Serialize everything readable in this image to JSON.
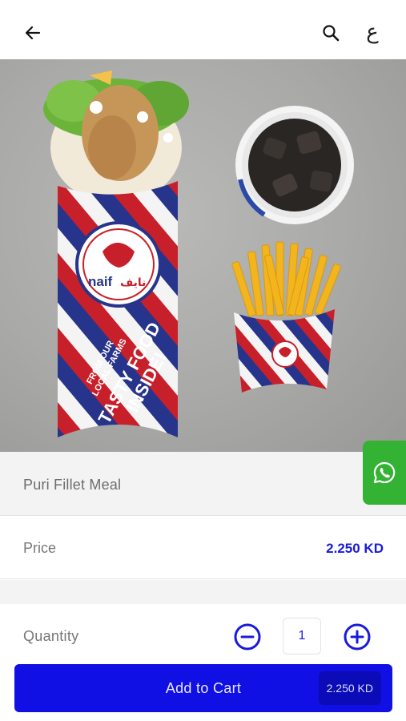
{
  "header": {
    "back_icon": "arrow-left-icon",
    "search_icon": "search-icon",
    "language_toggle": "ع"
  },
  "product": {
    "name": "Puri Fillet Meal",
    "image": {
      "wrap_text_line1": "TASTY FOOD",
      "wrap_text_line2": "INSIDE!",
      "wrap_sub_line1": "FROM OUR",
      "wrap_sub_line2": "LOCAL FARMS",
      "brand_logo_text": "naif",
      "brand_logo_arabic": "نايف"
    }
  },
  "price": {
    "label": "Price",
    "value": "2.250 KD"
  },
  "quantity": {
    "label": "Quantity",
    "value": "1",
    "minus_icon": "minus-circle-icon",
    "plus_icon": "plus-circle-icon"
  },
  "cart": {
    "label": "Add to Cart",
    "total": "2.250 KD"
  },
  "whatsapp": {
    "icon": "whatsapp-icon"
  },
  "colors": {
    "accent": "#1010e5",
    "price_text": "#1a1adb",
    "whatsapp_green": "#34b233"
  }
}
